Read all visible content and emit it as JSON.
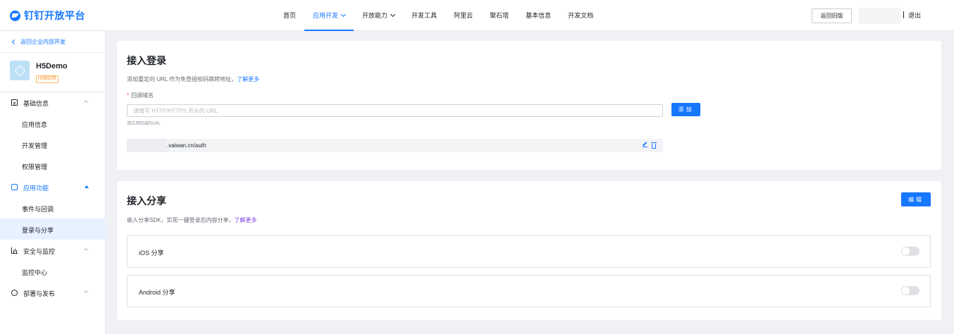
{
  "header": {
    "logo_text": "钉钉开放平台",
    "nav": [
      {
        "label": "首页",
        "active": false,
        "dropdown": false
      },
      {
        "label": "应用开发",
        "active": true,
        "dropdown": true
      },
      {
        "label": "开放能力",
        "active": false,
        "dropdown": true
      },
      {
        "label": "开发工具",
        "active": false,
        "dropdown": false
      },
      {
        "label": "阿里云",
        "active": false,
        "dropdown": false
      },
      {
        "label": "聚石塔",
        "active": false,
        "dropdown": false
      },
      {
        "label": "基本信息",
        "active": false,
        "dropdown": false
      },
      {
        "label": "开发文档",
        "active": false,
        "dropdown": false
      }
    ],
    "return_old_label": "返回旧版",
    "logout_label": "退出"
  },
  "sidebar": {
    "back_label": "返回企业内部开发",
    "app": {
      "name": "H5Demo",
      "badge": "H5微应用"
    },
    "groups": [
      {
        "label": "基础信息",
        "icon": "document-icon",
        "expanded": true,
        "items": [
          "应用信息",
          "开发管理",
          "权限管理"
        ]
      },
      {
        "label": "应用功能",
        "icon": "app-feature-icon",
        "expanded": true,
        "active": true,
        "items": [
          "事件与回调",
          "登录与分享"
        ]
      },
      {
        "label": "安全与监控",
        "icon": "bar-chart-icon",
        "expanded": true,
        "items": [
          "监控中心"
        ]
      },
      {
        "label": "部署与发布",
        "icon": "cube-icon",
        "expanded": false,
        "items": []
      }
    ],
    "active_item": "登录与分享"
  },
  "login": {
    "title": "接入登录",
    "desc": "添加重定向 URL 作为免登授权码跳转地址，",
    "learn_more": "了解更多",
    "field_label": "回调域名",
    "input_placeholder": "请填写 HTTP/HTTPS 开头的 URL",
    "input_value": "",
    "add_label": "添加",
    "hint": "请应用回调的URL",
    "urls": [
      ".vaiwan.cn/auth"
    ]
  },
  "share": {
    "title": "接入分享",
    "edit_label": "编辑",
    "desc": "嵌入分享SDK，实现一键登录后内容分享，",
    "learn_more": "了解更多",
    "rows": [
      {
        "label": "iOS 分享",
        "enabled": false
      },
      {
        "label": "Android 分享",
        "enabled": false
      }
    ]
  },
  "colors": {
    "accent": "#1677ff",
    "background": "#f0f1f4",
    "active_bg": "#e8f1ff"
  }
}
